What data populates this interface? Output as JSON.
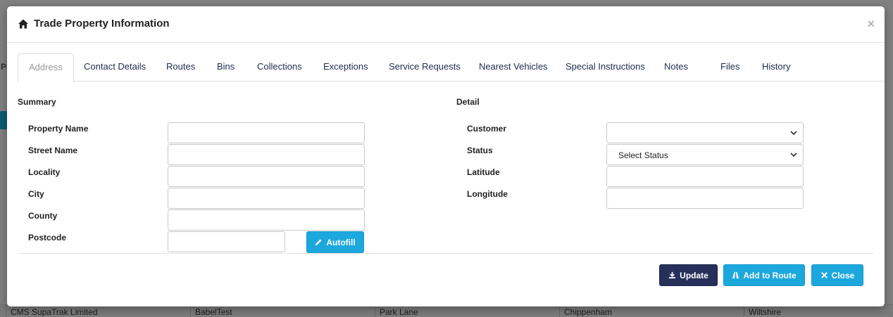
{
  "modal": {
    "title": "Trade Property Information",
    "close_symbol": "×",
    "header_icon": "home-icon"
  },
  "tabs": [
    {
      "label": "Address",
      "active": true
    },
    {
      "label": "Contact Details"
    },
    {
      "label": "Routes"
    },
    {
      "label": "Bins"
    },
    {
      "label": "Collections"
    },
    {
      "label": "Exceptions"
    },
    {
      "label": "Service Requests"
    },
    {
      "label": "Nearest Vehicles"
    },
    {
      "label": "Special Instructions"
    },
    {
      "label": "Notes"
    },
    {
      "label": "Files"
    },
    {
      "label": "History"
    }
  ],
  "summary": {
    "title": "Summary",
    "fields": [
      {
        "label": "Property Name",
        "value": ""
      },
      {
        "label": "Street Name",
        "value": ""
      },
      {
        "label": "Locality",
        "value": ""
      },
      {
        "label": "City",
        "value": ""
      },
      {
        "label": "County",
        "value": ""
      },
      {
        "label": "Postcode",
        "value": ""
      }
    ],
    "autofill_label": "Autofill"
  },
  "detail": {
    "title": "Detail",
    "customer_label": "Customer",
    "customer_value": "",
    "status_label": "Status",
    "status_value": "Select Status",
    "latitude_label": "Latitude",
    "latitude_value": "",
    "longitude_label": "Longitude",
    "longitude_value": ""
  },
  "footer": {
    "update_label": "Update",
    "add_to_route_label": "Add to Route",
    "close_label": "Close"
  },
  "background": {
    "row_cells": [
      "CMS SupaTrak Limited",
      "BabelTest",
      "Park Lane",
      "Chippenham",
      "Wiltshire"
    ],
    "left_fragment": "Pr"
  },
  "colors": {
    "primary_info": "#1ca8dd",
    "primary_navy": "#27305a",
    "tab_text": "#1e2b4d"
  }
}
